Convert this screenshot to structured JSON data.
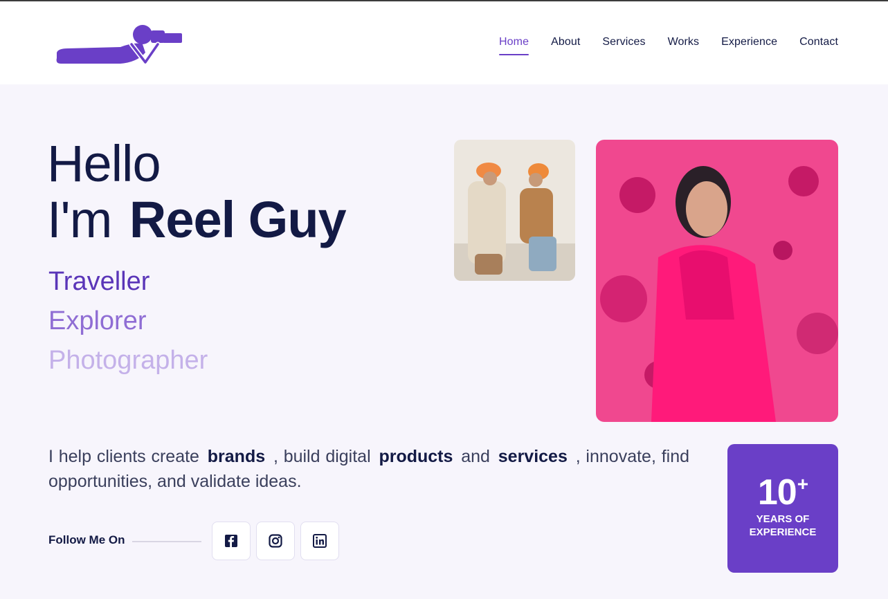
{
  "colors": {
    "accent": "#6a3fc7",
    "dark": "#131a45",
    "background": "#f7f5fc"
  },
  "logo": {
    "icon": "photographer-lying-camera-icon"
  },
  "nav": {
    "items": [
      {
        "label": "Home",
        "active": true
      },
      {
        "label": "About"
      },
      {
        "label": "Services"
      },
      {
        "label": "Works"
      },
      {
        "label": "Experience"
      },
      {
        "label": "Contact"
      }
    ]
  },
  "hero": {
    "greeting": "Hello",
    "intro": "I'm",
    "name": "Reel Guy",
    "roles": [
      "Traveller",
      "Explorer",
      "Photographer"
    ],
    "tagline": {
      "part1": "I help clients create",
      "bold1": "brands",
      "part2": ", build digital",
      "bold2": "products",
      "part3": "and",
      "bold3": "services",
      "part4": ", innovate, find opportunities, and validate ideas."
    }
  },
  "follow": {
    "label": "Follow Me On",
    "icons": [
      "facebook-icon",
      "instagram-icon",
      "linkedin-icon"
    ]
  },
  "experience": {
    "number": "10",
    "suffix": "+",
    "line1": "YEARS OF",
    "line2": "EXPERIENCE"
  }
}
